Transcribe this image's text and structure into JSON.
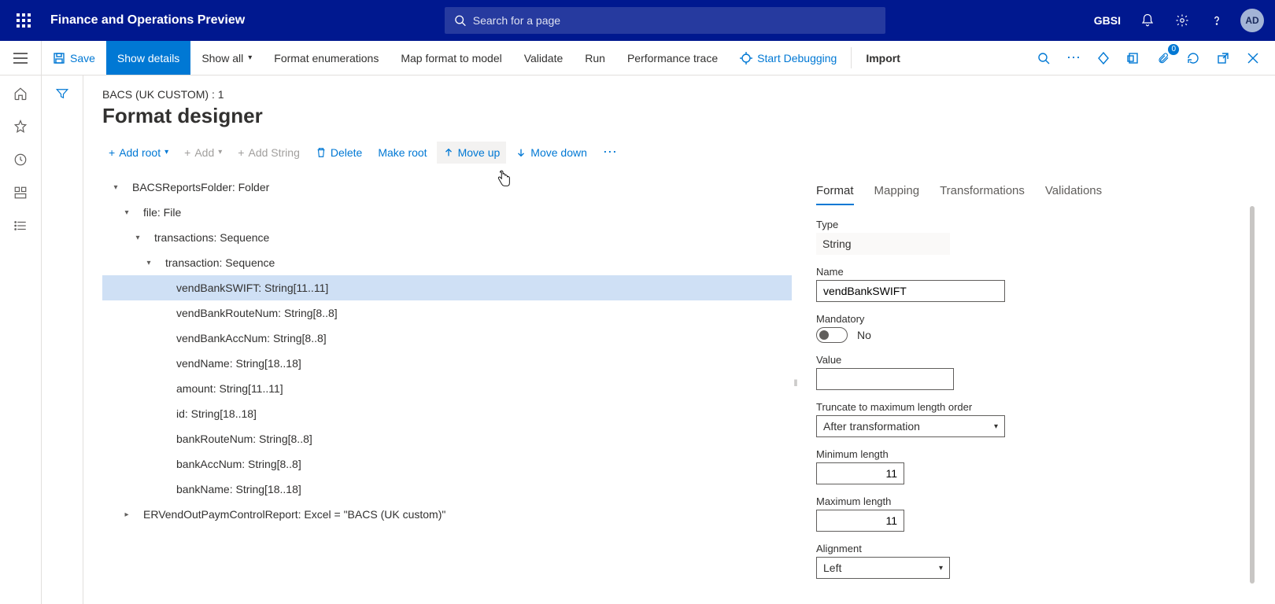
{
  "header": {
    "brand": "Finance and Operations Preview",
    "search_placeholder": "Search for a page",
    "company": "GBSI",
    "avatar": "AD"
  },
  "cmdbar": {
    "save": "Save",
    "show_details": "Show details",
    "show_all": "Show all",
    "format_enum": "Format enumerations",
    "map_format": "Map format to model",
    "validate": "Validate",
    "run": "Run",
    "perf_trace": "Performance trace",
    "start_debug": "Start Debugging",
    "import": "Import"
  },
  "page": {
    "breadcrumb": "BACS (UK CUSTOM) : 1",
    "title": "Format designer"
  },
  "toolbar": {
    "add_root": "Add root",
    "add": "Add",
    "add_string": "Add String",
    "delete": "Delete",
    "make_root": "Make root",
    "move_up": "Move up",
    "move_down": "Move down"
  },
  "tree": [
    {
      "indent": 0,
      "caret": "down",
      "label": "BACSReportsFolder: Folder",
      "selected": false
    },
    {
      "indent": 1,
      "caret": "down",
      "label": "file: File",
      "selected": false
    },
    {
      "indent": 2,
      "caret": "down",
      "label": "transactions: Sequence",
      "selected": false
    },
    {
      "indent": 3,
      "caret": "down",
      "label": "transaction: Sequence",
      "selected": false
    },
    {
      "indent": 4,
      "caret": "none",
      "label": "vendBankSWIFT: String[11..11]",
      "selected": true
    },
    {
      "indent": 4,
      "caret": "none",
      "label": "vendBankRouteNum: String[8..8]",
      "selected": false
    },
    {
      "indent": 4,
      "caret": "none",
      "label": "vendBankAccNum: String[8..8]",
      "selected": false
    },
    {
      "indent": 4,
      "caret": "none",
      "label": "vendName: String[18..18]",
      "selected": false
    },
    {
      "indent": 4,
      "caret": "none",
      "label": "amount: String[11..11]",
      "selected": false
    },
    {
      "indent": 4,
      "caret": "none",
      "label": "id: String[18..18]",
      "selected": false
    },
    {
      "indent": 4,
      "caret": "none",
      "label": "bankRouteNum: String[8..8]",
      "selected": false
    },
    {
      "indent": 4,
      "caret": "none",
      "label": "bankAccNum: String[8..8]",
      "selected": false
    },
    {
      "indent": 4,
      "caret": "none",
      "label": "bankName: String[18..18]",
      "selected": false
    },
    {
      "indent": 1,
      "caret": "right",
      "label": "ERVendOutPaymControlReport: Excel = \"BACS (UK custom)\"",
      "selected": false
    }
  ],
  "props": {
    "tabs": {
      "format": "Format",
      "mapping": "Mapping",
      "transformations": "Transformations",
      "validations": "Validations"
    },
    "type_label": "Type",
    "type_value": "String",
    "name_label": "Name",
    "name_value": "vendBankSWIFT",
    "mandatory_label": "Mandatory",
    "mandatory_text": "No",
    "value_label": "Value",
    "value_value": "",
    "truncate_label": "Truncate to maximum length order",
    "truncate_value": "After transformation",
    "minlen_label": "Minimum length",
    "minlen_value": "11",
    "maxlen_label": "Maximum length",
    "maxlen_value": "11",
    "align_label": "Alignment",
    "align_value": "Left"
  }
}
